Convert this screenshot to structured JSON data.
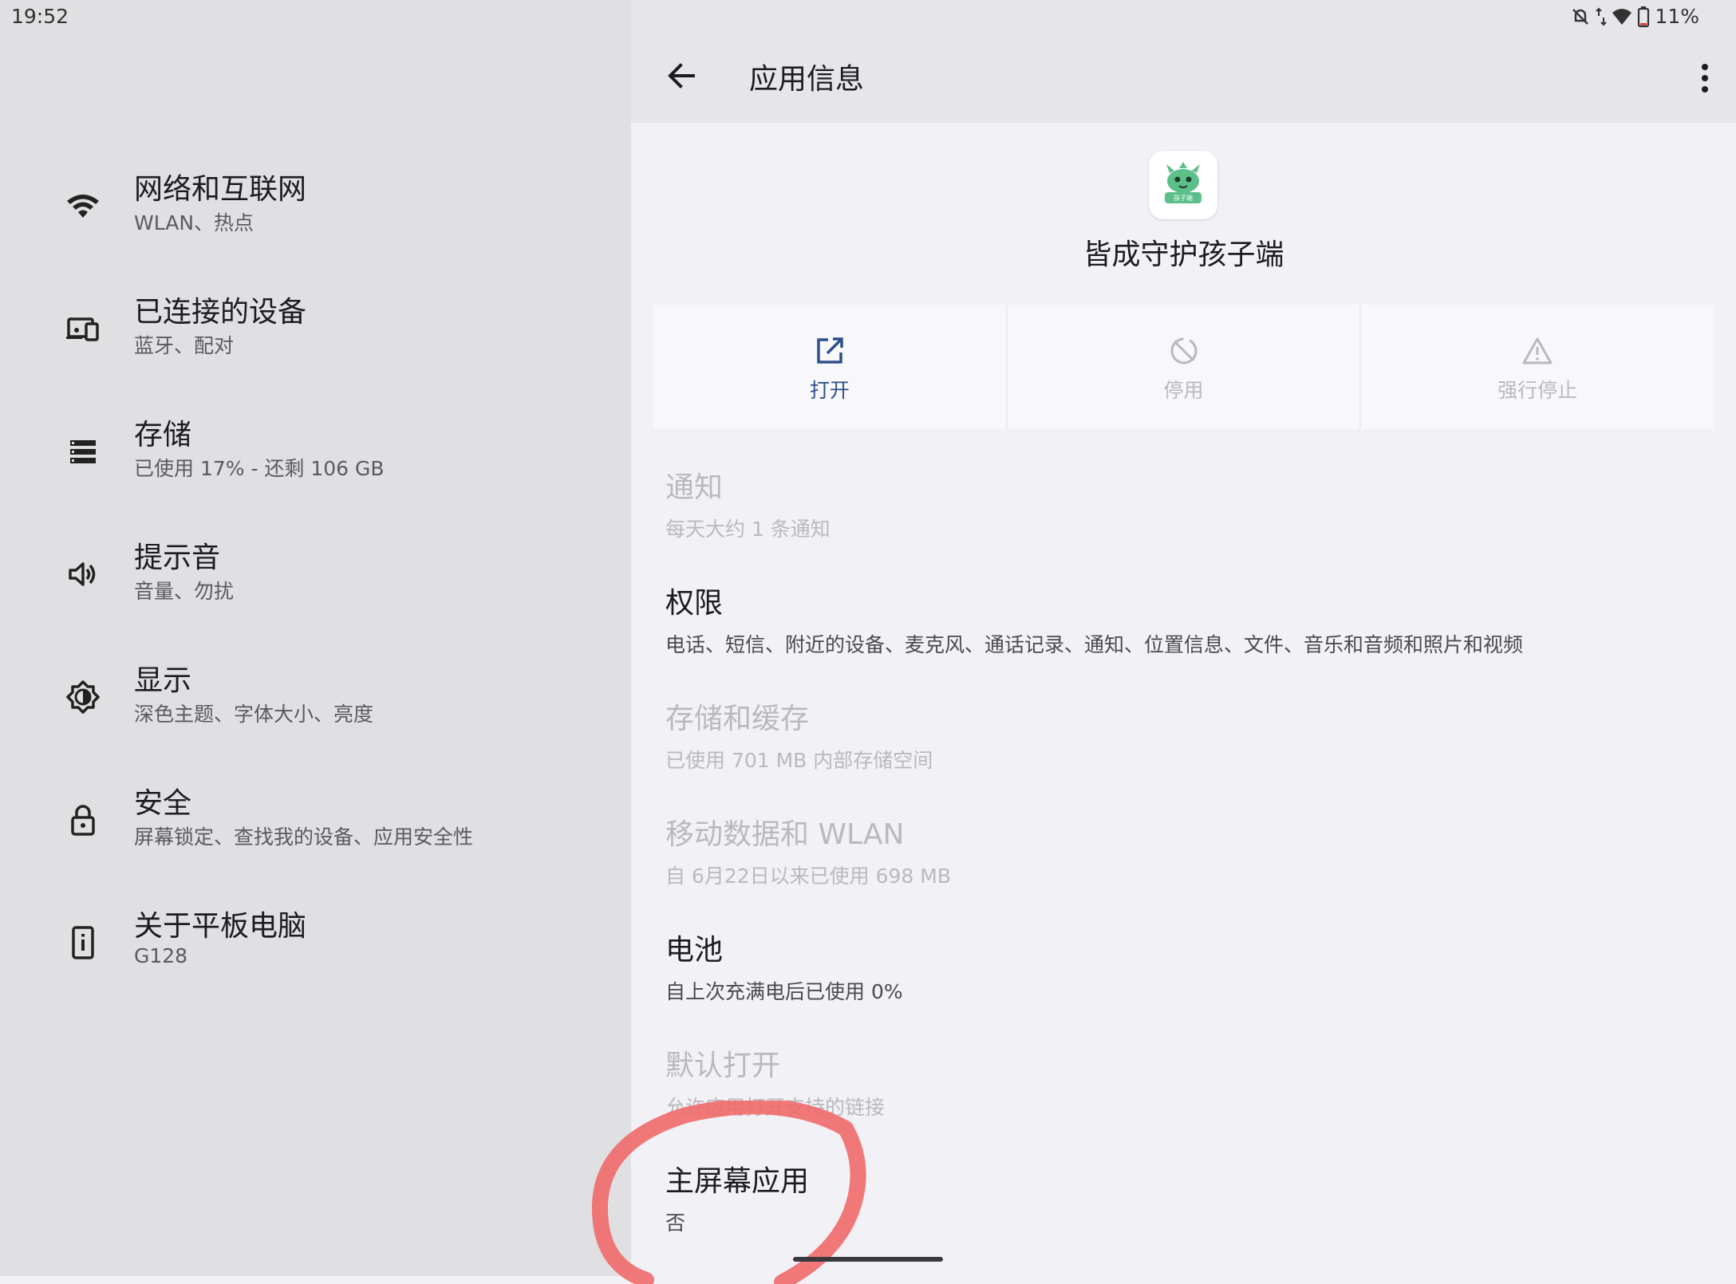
{
  "status": {
    "time": "19:52",
    "battery": "11%"
  },
  "settings": {
    "items": [
      {
        "icon": "wifi-icon",
        "title": "网络和互联网",
        "sub": "WLAN、热点"
      },
      {
        "icon": "connected-devices-icon",
        "title": "已连接的设备",
        "sub": "蓝牙、配对"
      },
      {
        "icon": "storage-icon",
        "title": "存储",
        "sub": "已使用 17% - 还剩 106 GB"
      },
      {
        "icon": "sound-icon",
        "title": "提示音",
        "sub": "音量、勿扰"
      },
      {
        "icon": "display-icon",
        "title": "显示",
        "sub": "深色主题、字体大小、亮度"
      },
      {
        "icon": "lock-icon",
        "title": "安全",
        "sub": "屏幕锁定、查找我的设备、应用安全性"
      },
      {
        "icon": "tablet-info-icon",
        "title": "关于平板电脑",
        "sub": "G128"
      }
    ]
  },
  "app_info": {
    "page_title": "应用信息",
    "app_name": "皆成守护孩子端",
    "app_icon_label": "孩子端",
    "actions": [
      {
        "icon": "open-icon",
        "label": "打开",
        "enabled": true
      },
      {
        "icon": "disable-icon",
        "label": "停用",
        "enabled": false
      },
      {
        "icon": "force-stop-icon",
        "label": "强行停止",
        "enabled": false
      }
    ],
    "prefs": [
      {
        "title": "通知",
        "sub": "每天大约 1 条通知",
        "enabled": false
      },
      {
        "title": "权限",
        "sub": "电话、短信、附近的设备、麦克风、通话记录、通知、位置信息、文件、音乐和音频和照片和视频",
        "enabled": true
      },
      {
        "title": "存储和缓存",
        "sub": "已使用 701 MB 内部存储空间",
        "enabled": false
      },
      {
        "title": "移动数据和 WLAN",
        "sub": "自 6月22日以来已使用 698 MB",
        "enabled": false
      },
      {
        "title": "电池",
        "sub": "自上次充满电后已使用 0%",
        "enabled": true
      },
      {
        "title": "默认打开",
        "sub": "允许应用打开支持的链接",
        "enabled": false
      },
      {
        "title": "主屏幕应用",
        "sub": "否",
        "enabled": true
      }
    ]
  },
  "colors": {
    "accent": "#2e4f8a",
    "annotation": "#f06a6a"
  }
}
